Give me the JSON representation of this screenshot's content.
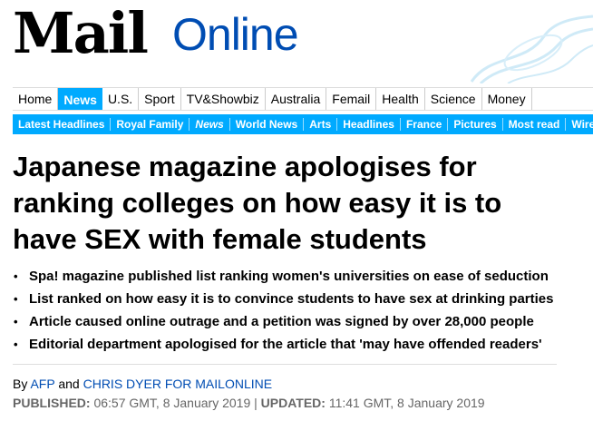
{
  "masthead": {
    "logo_mail": "Mail",
    "logo_online": "Online",
    "colors": {
      "online_blue": "#004db3",
      "accent_blue": "#00aaff"
    }
  },
  "nav_primary": [
    {
      "label": "Home",
      "active": false
    },
    {
      "label": "News",
      "active": true
    },
    {
      "label": "U.S.",
      "active": false
    },
    {
      "label": "Sport",
      "active": false
    },
    {
      "label": "TV&Showbiz",
      "active": false
    },
    {
      "label": "Australia",
      "active": false
    },
    {
      "label": "Femail",
      "active": false
    },
    {
      "label": "Health",
      "active": false
    },
    {
      "label": "Science",
      "active": false
    },
    {
      "label": "Money",
      "active": false
    }
  ],
  "nav_secondary": [
    {
      "label": "Latest Headlines",
      "active": false
    },
    {
      "label": "Royal Family",
      "active": false
    },
    {
      "label": "News",
      "active": true
    },
    {
      "label": "World News",
      "active": false
    },
    {
      "label": "Arts",
      "active": false
    },
    {
      "label": "Headlines",
      "active": false
    },
    {
      "label": "France",
      "active": false
    },
    {
      "label": "Pictures",
      "active": false
    },
    {
      "label": "Most read",
      "active": false
    },
    {
      "label": "Wires",
      "active": false
    }
  ],
  "article": {
    "headline": "Japanese magazine apologises for ranking colleges on how easy it is to have SEX with female students",
    "bullets": [
      "Spa! magazine published list ranking women's universities on ease of seduction",
      "List ranked on how easy it is to convince students to have sex at drinking parties",
      "Article caused online outrage and a petition was signed by over 28,000 people",
      "Editorial department apologised for the article that 'may have offended readers'"
    ],
    "byline": {
      "prefix": "By",
      "author1": "AFP",
      "conjunction": "and",
      "author2": "CHRIS DYER FOR MAILONLINE"
    },
    "dates": {
      "published_label": "PUBLISHED:",
      "published_value": "06:57 GMT, 8 January 2019",
      "separator": "|",
      "updated_label": "UPDATED:",
      "updated_value": "11:41 GMT, 8 January 2019"
    }
  }
}
